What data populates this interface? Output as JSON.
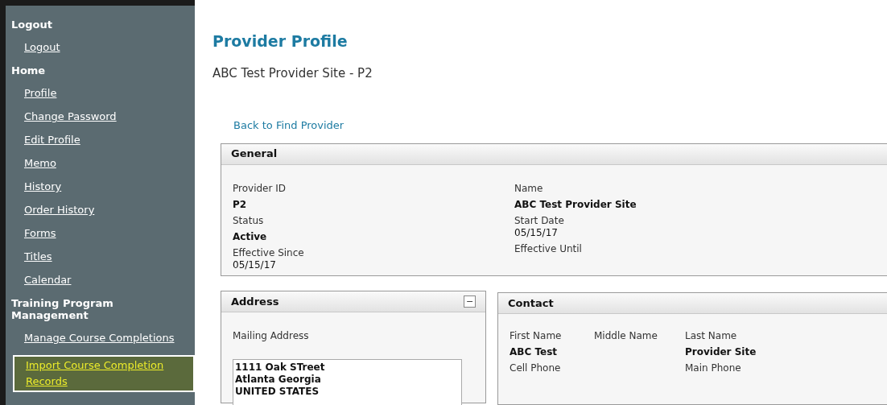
{
  "sidebar": {
    "sections": [
      {
        "heading": "Logout",
        "links": [
          {
            "label": "Logout",
            "selected": false
          }
        ]
      },
      {
        "heading": "Home",
        "links": [
          {
            "label": "Profile",
            "selected": false
          },
          {
            "label": "Change Password",
            "selected": false
          },
          {
            "label": "Edit Profile",
            "selected": false
          },
          {
            "label": "Memo",
            "selected": false
          },
          {
            "label": "History",
            "selected": false
          },
          {
            "label": "Order History",
            "selected": false
          },
          {
            "label": "Forms",
            "selected": false
          },
          {
            "label": "Titles",
            "selected": false
          },
          {
            "label": "Calendar",
            "selected": false
          }
        ]
      },
      {
        "heading": "Training Program Management",
        "links": [
          {
            "label": "Manage Course Completions",
            "selected": false
          },
          {
            "label": "Import Course Completion Records",
            "selected": true
          }
        ]
      }
    ]
  },
  "page": {
    "title": "Provider Profile",
    "subtitle": "ABC Test Provider Site - P2",
    "back_link": "Back to Find Provider"
  },
  "general": {
    "title": "General",
    "columns": [
      [
        {
          "label": "Provider ID",
          "value": "P2",
          "bold": true
        },
        {
          "label": "Status",
          "value": "Active",
          "bold": true
        },
        {
          "label": "Effective Since",
          "value": "05/15/17",
          "bold": false
        }
      ],
      [
        {
          "label": "Name",
          "value": "ABC Test Provider Site",
          "bold": true
        },
        {
          "label": "Start Date",
          "value": "05/15/17",
          "bold": false
        },
        {
          "label": "Effective Until"
        }
      ]
    ]
  },
  "address": {
    "title": "Address",
    "collapse_button": "−",
    "label": "Mailing Address",
    "lines": [
      "1111 Oak STreet",
      "Atlanta Georgia",
      "UNITED STATES"
    ]
  },
  "contact": {
    "title": "Contact",
    "columns": [
      [
        {
          "label": "First Name",
          "value": "ABC Test",
          "bold": true
        },
        {
          "label": "Cell Phone"
        }
      ],
      [
        {
          "label": "Middle Name"
        }
      ],
      [
        {
          "label": "Last Name",
          "value": "Provider Site",
          "bold": true
        },
        {
          "label": "Main Phone"
        }
      ]
    ]
  }
}
